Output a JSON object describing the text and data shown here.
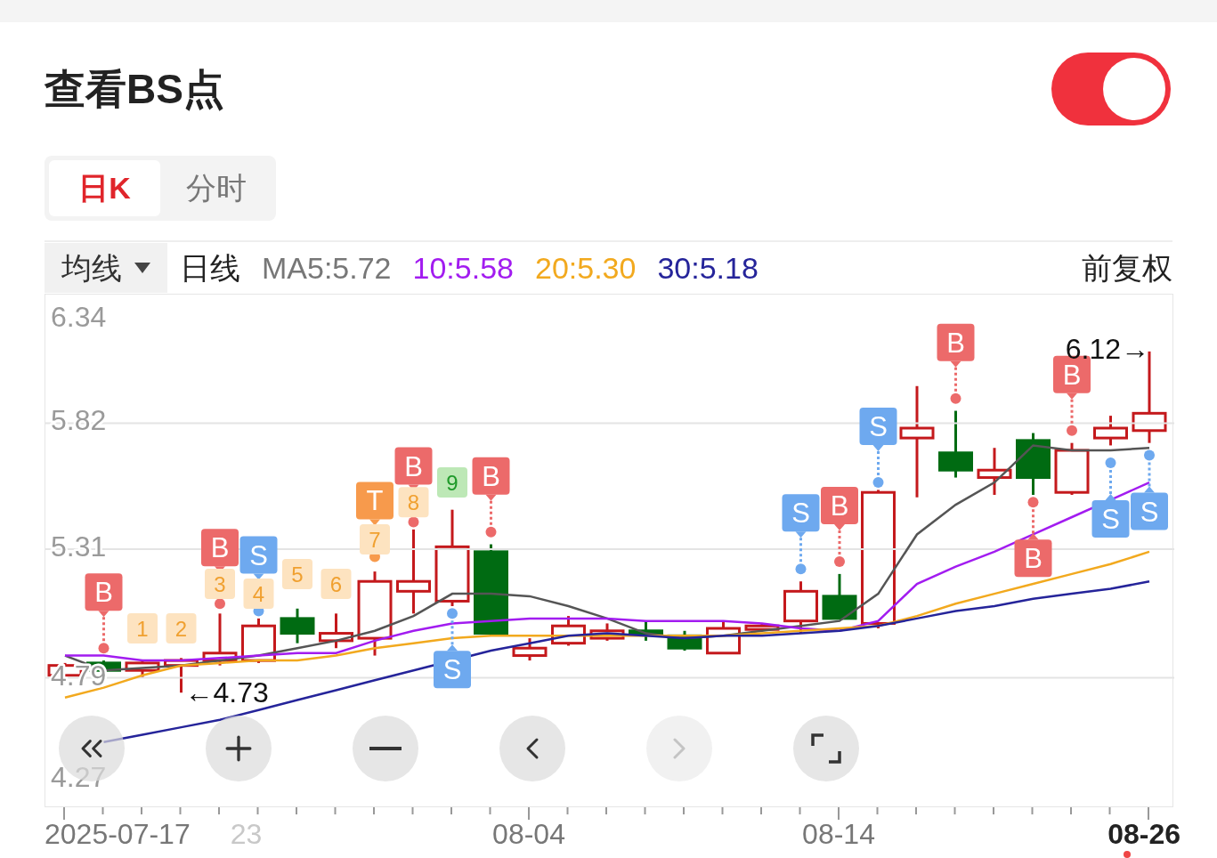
{
  "title": "查看BS点",
  "toggle": {
    "on": true
  },
  "tabs": [
    {
      "label": "日K",
      "selected": true
    },
    {
      "label": "分时",
      "selected": false
    }
  ],
  "indicator_dropdown": {
    "label": "均线"
  },
  "legend": [
    {
      "text": "日线",
      "color": "#222222"
    },
    {
      "text": "MA5:5.72",
      "color": "#777777"
    },
    {
      "text": "10:5.58",
      "color": "#a21cf0"
    },
    {
      "text": "20:5.30",
      "color": "#f2a91e"
    },
    {
      "text": "30:5.18",
      "color": "#25249a"
    }
  ],
  "adjustment": "前复权",
  "chart_data": {
    "type": "line",
    "ylim": [
      4.27,
      6.34
    ],
    "grid": true,
    "yticks": [
      {
        "value": 6.34,
        "label": "6.34"
      },
      {
        "value": 5.82,
        "label": "5.82"
      },
      {
        "value": 5.31,
        "label": "5.31"
      },
      {
        "value": 4.79,
        "label": "4.79"
      },
      {
        "value": 4.27,
        "label": "4.27"
      }
    ],
    "series": [
      {
        "color": "#555555",
        "values": [
          4.88,
          4.82,
          4.83,
          4.84,
          4.86,
          4.88,
          4.91,
          4.94,
          4.98,
          5.04,
          5.13,
          5.13,
          5.12,
          5.08,
          5.03,
          4.97,
          4.95,
          4.96,
          4.98,
          5.0,
          5.02,
          5.13,
          5.37,
          5.49,
          5.58,
          5.73,
          5.71,
          5.71,
          5.72
        ]
      },
      {
        "color": "#a21cf0",
        "values": [
          4.88,
          4.88,
          4.86,
          4.86,
          4.87,
          4.88,
          4.89,
          4.89,
          4.94,
          4.98,
          5.01,
          5.02,
          5.03,
          5.03,
          5.03,
          5.02,
          5.02,
          5.02,
          5.01,
          4.99,
          4.98,
          5.02,
          5.17,
          5.24,
          5.3,
          5.37,
          5.44,
          5.51,
          5.58
        ]
      },
      {
        "color": "#f2a91e",
        "values": [
          4.71,
          4.75,
          4.8,
          4.84,
          4.85,
          4.86,
          4.86,
          4.88,
          4.91,
          4.93,
          4.95,
          4.96,
          4.96,
          4.96,
          4.96,
          null,
          null,
          4.96,
          4.97,
          4.98,
          4.99,
          5.0,
          5.04,
          5.09,
          5.13,
          5.17,
          5.21,
          5.25,
          5.3
        ]
      },
      {
        "color": "#25249a",
        "values": [
          null,
          4.53,
          4.56,
          4.59,
          4.62,
          4.66,
          4.7,
          4.74,
          4.78,
          4.82,
          null,
          4.9,
          4.93,
          4.96,
          4.97,
          4.96,
          4.95,
          4.96,
          4.96,
          4.97,
          4.98,
          5.0,
          5.03,
          5.06,
          5.08,
          5.11,
          5.13,
          5.15,
          5.18
        ]
      }
    ]
  },
  "candles": [
    {
      "kind": "up"
    },
    {
      "kind": "down",
      "signals": [
        {
          "label": "B",
          "kind": "buy",
          "below": false
        }
      ]
    },
    {
      "kind": "up",
      "signals": [
        {
          "label": "1",
          "kind": "count"
        }
      ]
    },
    {
      "kind": "up",
      "signals": [
        {
          "label": "2",
          "kind": "count"
        }
      ]
    },
    {
      "kind": "up",
      "signals": [
        {
          "label": "B",
          "kind": "buy",
          "below": false
        },
        {
          "label": "3",
          "kind": "count"
        }
      ]
    },
    {
      "kind": "up",
      "signals": [
        {
          "label": "S",
          "kind": "sell",
          "below": false
        },
        {
          "label": "4",
          "kind": "count"
        }
      ]
    },
    {
      "kind": "down",
      "signals": [
        {
          "label": "5",
          "kind": "count"
        }
      ]
    },
    {
      "kind": "up",
      "signals": [
        {
          "label": "6",
          "kind": "count"
        }
      ]
    },
    {
      "kind": "up",
      "signals": [
        {
          "label": "T",
          "kind": "turn",
          "below": false
        },
        {
          "label": "7",
          "kind": "count"
        }
      ]
    },
    {
      "kind": "up",
      "signals": [
        {
          "label": "B",
          "kind": "buy",
          "below": false
        },
        {
          "label": "8",
          "kind": "count"
        }
      ]
    },
    {
      "kind": "up",
      "signals": [
        {
          "label": "9",
          "kind": "count_end"
        },
        {
          "label": "S",
          "kind": "sell",
          "below": true
        }
      ]
    },
    {
      "kind": "down",
      "signals": [
        {
          "label": "B",
          "kind": "buy",
          "below": false
        }
      ]
    },
    {
      "kind": "up"
    },
    {
      "kind": "up"
    },
    {
      "kind": "up"
    },
    {
      "kind": "down"
    },
    {
      "kind": "down"
    },
    {
      "kind": "up"
    },
    {
      "kind": "up"
    },
    {
      "kind": "up",
      "signals": [
        {
          "label": "S",
          "kind": "sell",
          "below": false
        }
      ]
    },
    {
      "kind": "down",
      "signals": [
        {
          "label": "B",
          "kind": "buy",
          "below": false
        }
      ]
    },
    {
      "kind": "up",
      "signals": [
        {
          "label": "S",
          "kind": "sell",
          "below": false
        }
      ]
    },
    {
      "kind": "up"
    },
    {
      "kind": "down",
      "signals": [
        {
          "label": "B",
          "kind": "buy",
          "below": false
        }
      ]
    },
    {
      "kind": "up"
    },
    {
      "kind": "down",
      "signals": [
        {
          "label": "B",
          "kind": "buy",
          "below": true
        }
      ]
    },
    {
      "kind": "up",
      "signals": [
        {
          "label": "B",
          "kind": "buy",
          "below": false
        }
      ]
    },
    {
      "kind": "up",
      "signals": [
        {
          "label": "S",
          "kind": "sell",
          "below": true
        }
      ]
    },
    {
      "kind": "up",
      "signals": [
        {
          "label": "S",
          "kind": "sell",
          "below": true
        }
      ]
    }
  ],
  "price_extremes": [
    {
      "text": "6.12→",
      "kind": "high"
    },
    {
      "text": "←4.73",
      "kind": "low"
    }
  ],
  "x_axis_labels": [
    {
      "text": "2025-07-17",
      "kind": "start"
    },
    {
      "text": "23",
      "kind": "faded"
    },
    {
      "text": "08-04",
      "kind": "date"
    },
    {
      "text": "08-14",
      "kind": "date"
    },
    {
      "text": "08-26",
      "kind": "current"
    }
  ],
  "chart_controls": [
    {
      "kind": "rewind",
      "disabled": false
    },
    {
      "kind": "zoom_in",
      "disabled": false
    },
    {
      "kind": "zoom_out",
      "disabled": false
    },
    {
      "kind": "back",
      "disabled": false
    },
    {
      "kind": "forward",
      "disabled": true
    },
    {
      "kind": "fullscreen",
      "disabled": false
    }
  ]
}
